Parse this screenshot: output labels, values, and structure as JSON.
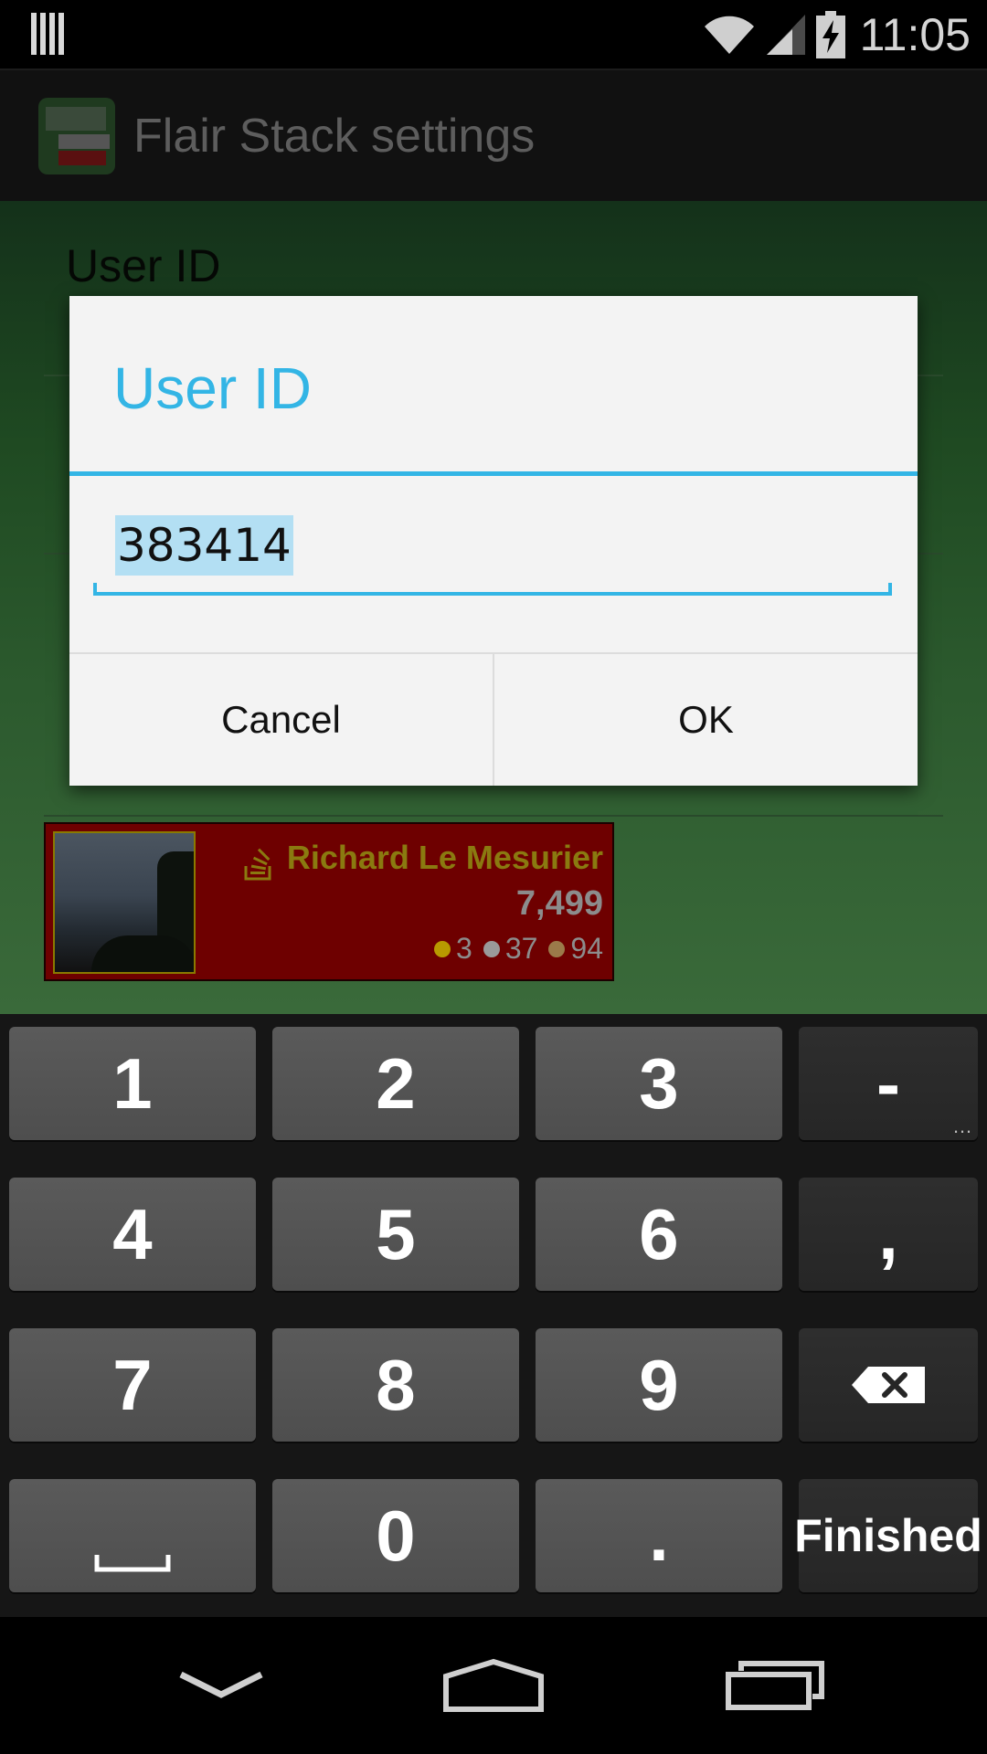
{
  "status_bar": {
    "time": "11:05",
    "icons": [
      "notification-icon",
      "wifi-icon",
      "signal-icon",
      "battery-charging-icon"
    ]
  },
  "app_bar": {
    "title": "Flair Stack settings",
    "icon": "app-icon"
  },
  "settings": {
    "pref_user_id_title": "User ID",
    "flair_preview": {
      "name": "Richard Le Mesurier",
      "reputation": "7,499",
      "badges": {
        "gold": "3",
        "silver": "37",
        "bronze": "94"
      }
    }
  },
  "dialog": {
    "title": "User ID",
    "input_value": "383414",
    "cancel_label": "Cancel",
    "ok_label": "OK"
  },
  "keyboard": {
    "rows": [
      [
        "1",
        "2",
        "3",
        "-"
      ],
      [
        "4",
        "5",
        "6",
        ","
      ],
      [
        "7",
        "8",
        "9",
        "backspace"
      ],
      [
        "space",
        "0",
        ".",
        "Finished"
      ]
    ],
    "key_1": "1",
    "key_2": "2",
    "key_3": "3",
    "key_dash": "-",
    "key_4": "4",
    "key_5": "5",
    "key_6": "6",
    "key_comma": ",",
    "key_7": "7",
    "key_8": "8",
    "key_9": "9",
    "key_0": "0",
    "key_dot": ".",
    "key_finished": "Finished",
    "dash_hint": "…"
  },
  "colors": {
    "accent": "#33b5e5",
    "flair_bg": "#6e0000",
    "flair_name": "#8a7a10",
    "gold": "#b89a00",
    "silver": "#9a9a9a",
    "bronze": "#9b7a4a"
  }
}
